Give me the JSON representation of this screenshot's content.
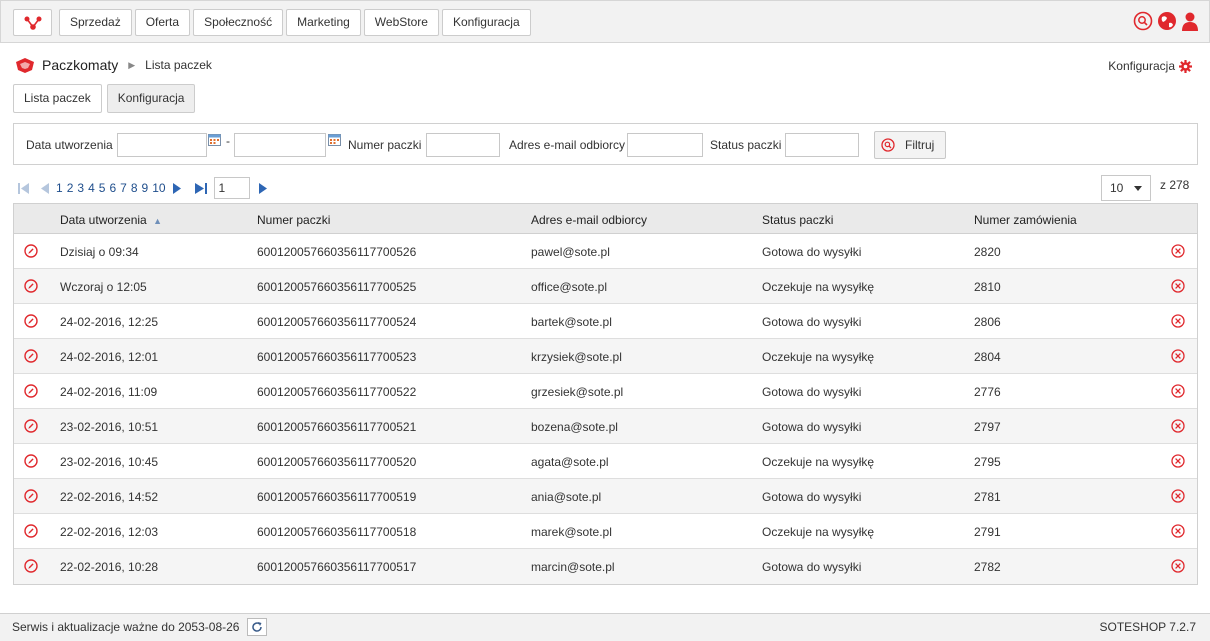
{
  "nav": {
    "items": [
      "Sprzedaż",
      "Oferta",
      "Społeczność",
      "Marketing",
      "WebStore",
      "Konfiguracja"
    ]
  },
  "breadcrumb": {
    "module": "Paczkomaty",
    "current": "Lista paczek"
  },
  "config_link": "Konfiguracja",
  "tabs": [
    {
      "label": "Lista paczek",
      "active": true
    },
    {
      "label": "Konfiguracja",
      "active": false
    }
  ],
  "filter": {
    "date_label": "Data utworzenia",
    "date_sep": "-",
    "number_label": "Numer paczki",
    "email_label": "Adres e-mail odbiorcy",
    "status_label": "Status paczki",
    "button_label": "Filtruj"
  },
  "pager": {
    "pages": [
      "1",
      "2",
      "3",
      "4",
      "5",
      "6",
      "7",
      "8",
      "9",
      "10"
    ],
    "current_input": "1",
    "per_page": "10",
    "total": "z 278"
  },
  "table": {
    "headers": [
      "Data utworzenia",
      "Numer paczki",
      "Adres e-mail odbiorcy",
      "Status paczki",
      "Numer zamówienia"
    ],
    "rows": [
      {
        "date": "Dzisiaj o 09:34",
        "number": "600120057660356117700526",
        "email": "pawel@sote.pl",
        "status": "Gotowa do wysyłki",
        "order": "2820"
      },
      {
        "date": "Wczoraj o 12:05",
        "number": "600120057660356117700525",
        "email": "office@sote.pl",
        "status": "Oczekuje na wysyłkę",
        "order": "2810"
      },
      {
        "date": "24-02-2016, 12:25",
        "number": "600120057660356117700524",
        "email": "bartek@sote.pl",
        "status": "Gotowa do wysyłki",
        "order": "2806"
      },
      {
        "date": "24-02-2016, 12:01",
        "number": "600120057660356117700523",
        "email": "krzysiek@sote.pl",
        "status": "Oczekuje na wysyłkę",
        "order": "2804"
      },
      {
        "date": "24-02-2016, 11:09",
        "number": "600120057660356117700522",
        "email": "grzesiek@sote.pl",
        "status": "Gotowa do wysyłki",
        "order": "2776"
      },
      {
        "date": "23-02-2016, 10:51",
        "number": "600120057660356117700521",
        "email": "bozena@sote.pl",
        "status": "Gotowa do wysyłki",
        "order": "2797"
      },
      {
        "date": "23-02-2016, 10:45",
        "number": "600120057660356117700520",
        "email": "agata@sote.pl",
        "status": "Oczekuje na wysyłkę",
        "order": "2795"
      },
      {
        "date": "22-02-2016, 14:52",
        "number": "600120057660356117700519",
        "email": "ania@sote.pl",
        "status": "Gotowa do wysyłki",
        "order": "2781"
      },
      {
        "date": "22-02-2016, 12:03",
        "number": "600120057660356117700518",
        "email": "marek@sote.pl",
        "status": "Oczekuje na wysyłkę",
        "order": "2791"
      },
      {
        "date": "22-02-2016, 10:28",
        "number": "600120057660356117700517",
        "email": "marcin@sote.pl",
        "status": "Gotowa do wysyłki",
        "order": "2782"
      }
    ]
  },
  "footer": {
    "service_text": "Serwis i aktualizacje ważne do 2053-08-26",
    "version": "SOTESHOP 7.2.7"
  },
  "colors": {
    "accent": "#e0282d",
    "link": "#1f4e8c"
  }
}
